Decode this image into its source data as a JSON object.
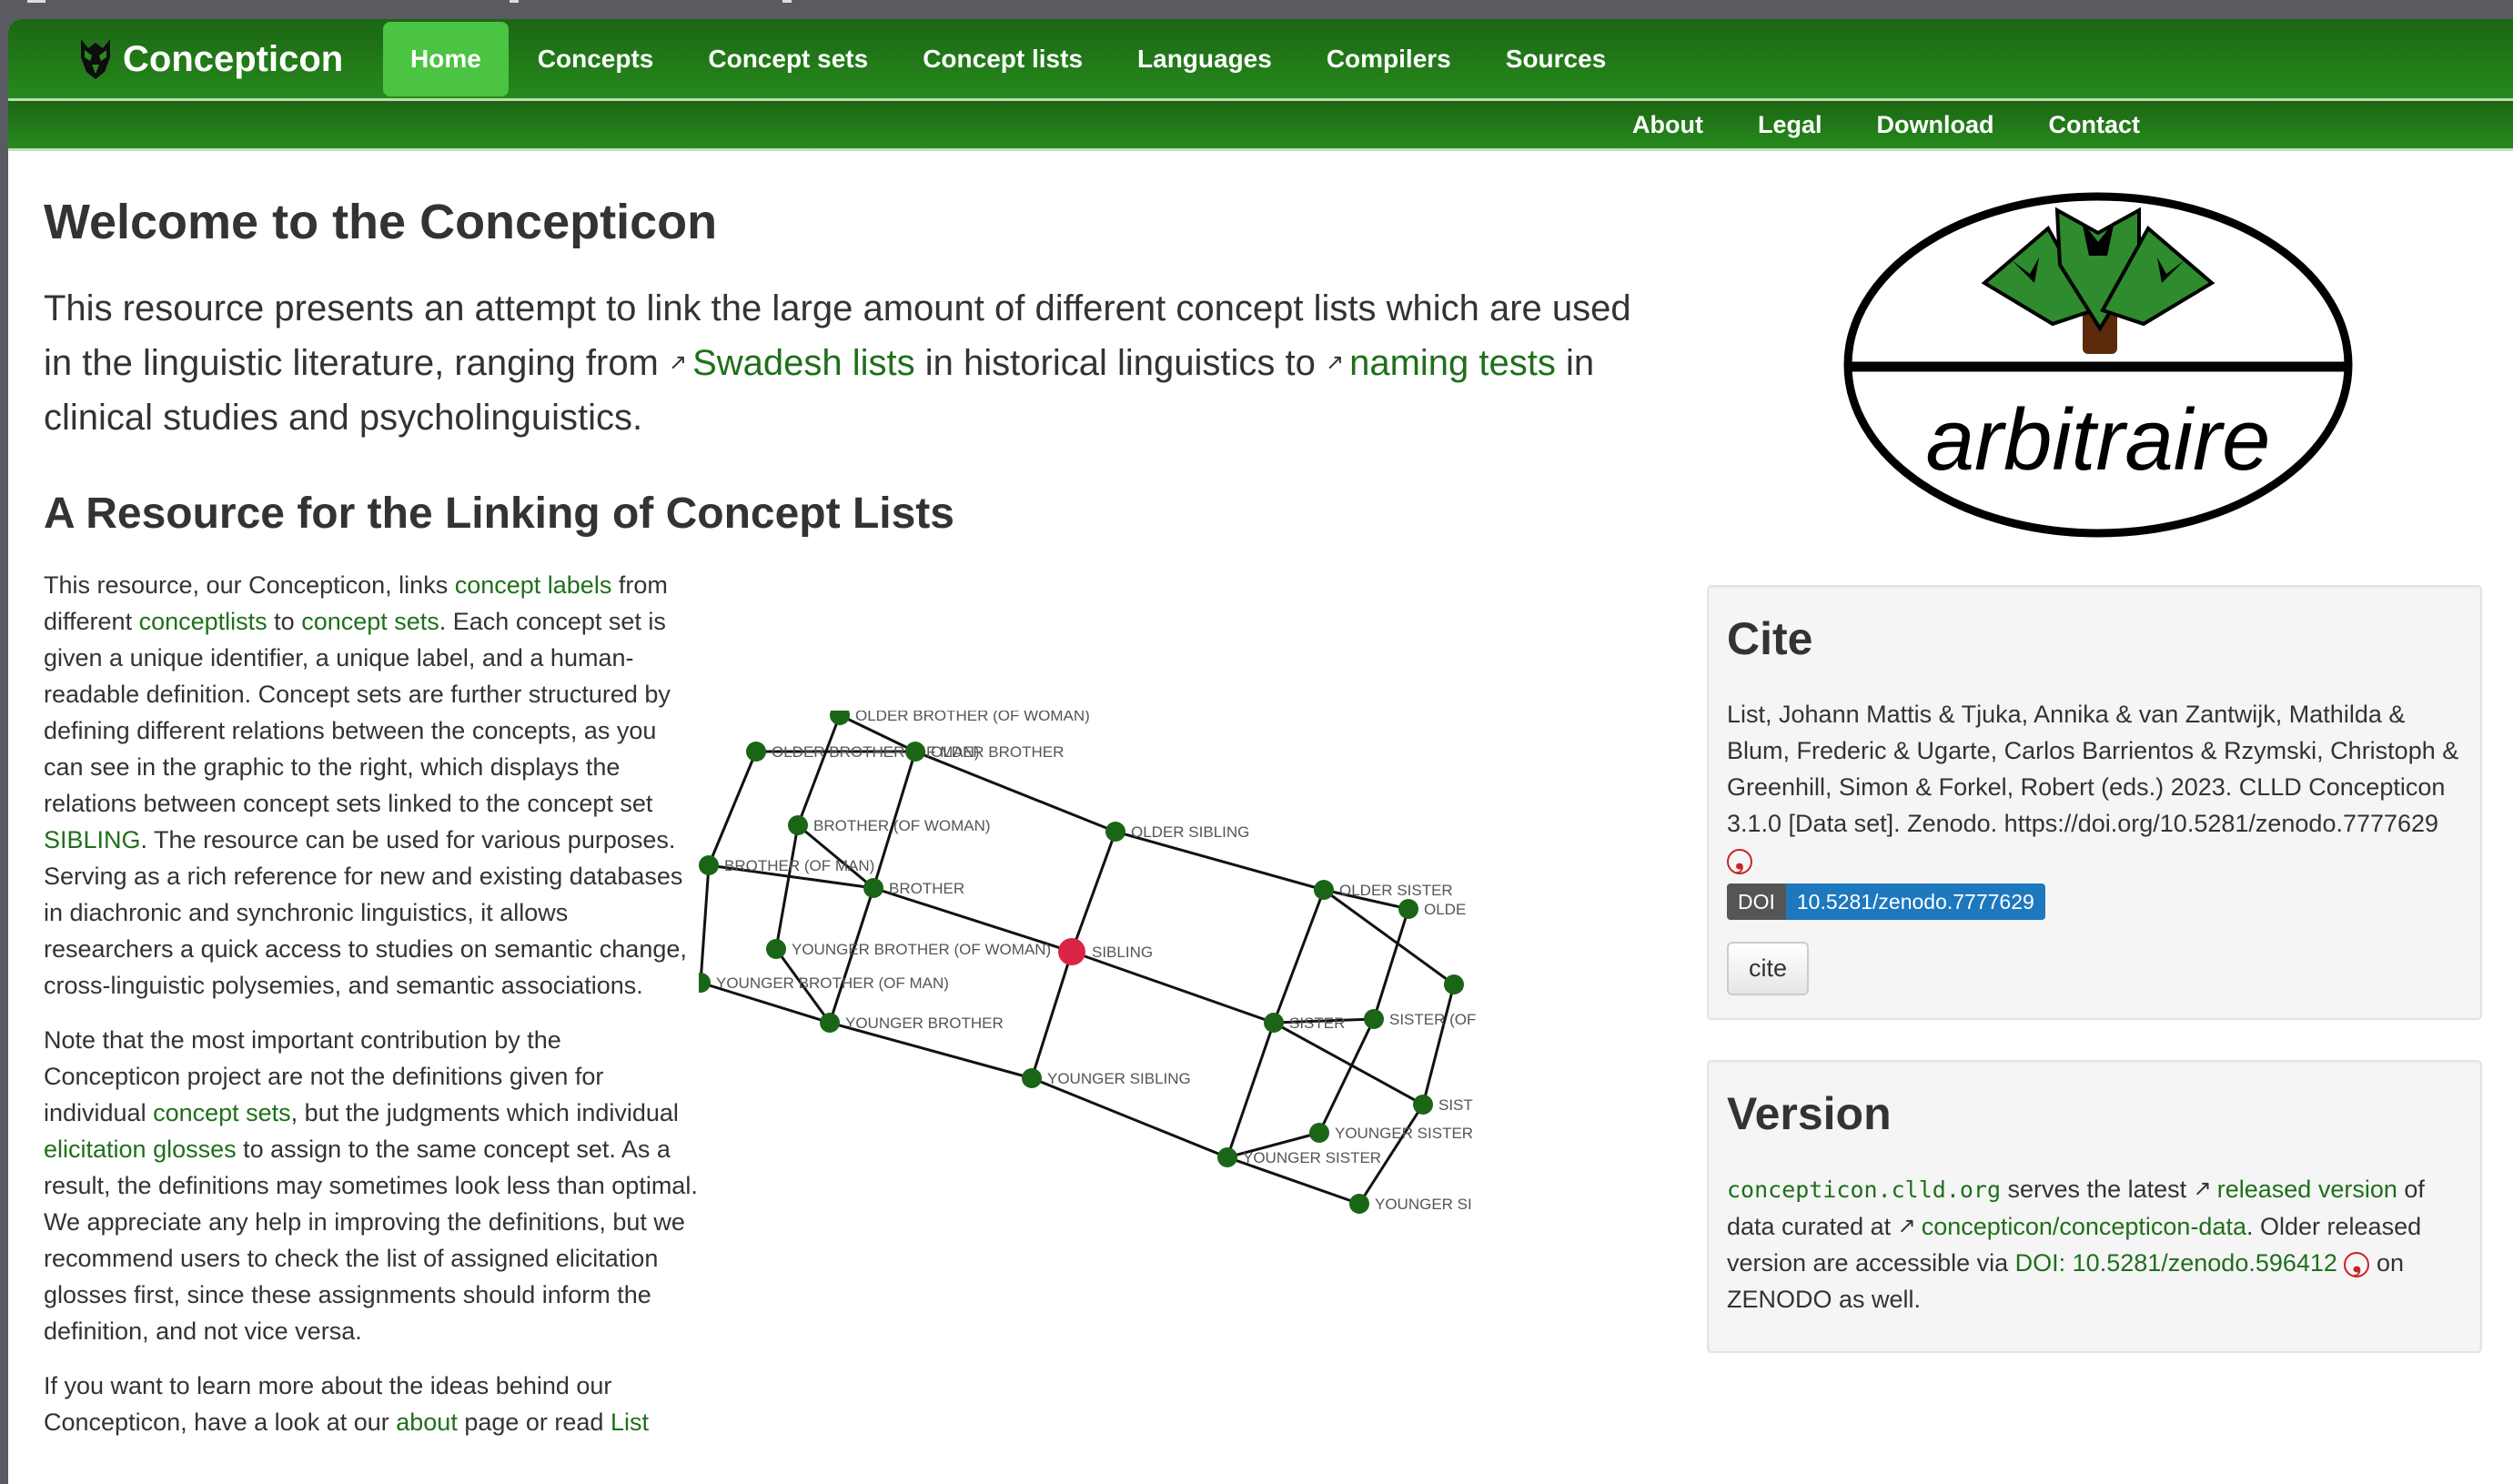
{
  "navbar": {
    "brand": "Concepticon",
    "items": [
      {
        "label": "Home",
        "active": true
      },
      {
        "label": "Concepts"
      },
      {
        "label": "Concept sets"
      },
      {
        "label": "Concept lists"
      },
      {
        "label": "Languages"
      },
      {
        "label": "Compilers"
      },
      {
        "label": "Sources"
      }
    ],
    "sub_items": [
      {
        "label": "About"
      },
      {
        "label": "Legal"
      },
      {
        "label": "Download"
      },
      {
        "label": "Contact"
      }
    ]
  },
  "main": {
    "title": "Welcome to the Concepticon",
    "lead": {
      "t1": "This resource presents an attempt to link the large amount of different concept lists which are used in the linguistic literature, ranging from ",
      "link1": "Swadesh lists",
      "t2": " in historical linguistics to ",
      "link2": "naming tests",
      "t3": " in clinical studies and psycholinguistics."
    },
    "subtitle": "A Resource for the Linking of Concept Lists",
    "p1": {
      "t1": "This resource, our Concepticon, links ",
      "l1": "concept labels",
      "t2": " from different ",
      "l2": "conceptlists",
      "t3": " to ",
      "l3": "concept sets",
      "t4": ". Each concept set is given a unique identifier, a unique label, and a human-readable definition. Concept sets are further structured by defining different relations between the concepts, as you can see in the graphic to the right, which displays the relations between concept sets linked to the concept set ",
      "l4": "SIBLING",
      "t5": ". The resource can be used for various purposes. Serving as a rich reference for new and existing databases in diachronic and synchronic linguistics, it allows researchers a quick access to studies on semantic change, cross-linguistic polysemies, and semantic associations."
    },
    "p2": {
      "t1": "Note that the most important contribution by the Concepticon project are not the definitions given for individual ",
      "l1": "concept sets",
      "t2": ", but the judgments which individual ",
      "l2": "elicitation glosses",
      "t3": " to assign to the same concept set. As a result, the definitions may sometimes look less than optimal. We appreciate any help in improving the definitions, but we recommend users to check the list of assigned elicitation glosses first, since these assignments should inform the definition, and not vice versa."
    },
    "p3": {
      "t1": "If you want to learn more about the ideas behind our Concepticon, have a look at our ",
      "l1": "about",
      "t2": " page or read ",
      "l2": "List"
    }
  },
  "graph": {
    "node_color": "#1a6616",
    "focus_color": "#dc2446",
    "nodes": [
      {
        "id": "obw",
        "label": "OLDER BROTHER (OF WOMAN)"
      },
      {
        "id": "obm",
        "label": "OLDER BROTHER (OF MAN)"
      },
      {
        "id": "ob",
        "label": "OLDER BROTHER"
      },
      {
        "id": "bw",
        "label": "BROTHER (OF WOMAN)"
      },
      {
        "id": "bm",
        "label": "BROTHER (OF MAN)"
      },
      {
        "id": "b",
        "label": "BROTHER"
      },
      {
        "id": "ybw",
        "label": "YOUNGER BROTHER (OF WOMAN)"
      },
      {
        "id": "ybm",
        "label": "YOUNGER BROTHER (OF MAN)"
      },
      {
        "id": "yb",
        "label": "YOUNGER BROTHER"
      },
      {
        "id": "sib",
        "label": "SIBLING",
        "focus": true
      },
      {
        "id": "os",
        "label": "OLDER SIBLING"
      },
      {
        "id": "ys",
        "label": "YOUNGER SIBLING"
      },
      {
        "id": "osis",
        "label": "OLDER SISTER"
      },
      {
        "id": "osis2",
        "label": "OLDE"
      },
      {
        "id": "osis3",
        "label": ""
      },
      {
        "id": "sis",
        "label": "SISTER"
      },
      {
        "id": "sis2",
        "label": "SISTER (OF"
      },
      {
        "id": "sis3",
        "label": "SIST"
      },
      {
        "id": "ysis2",
        "label": "YOUNGER SISTER"
      },
      {
        "id": "ysis",
        "label": "YOUNGER SISTER"
      },
      {
        "id": "ysis3",
        "label": "YOUNGER SI"
      }
    ],
    "edges": [
      [
        "obw",
        "ob"
      ],
      [
        "obw",
        "bw"
      ],
      [
        "obm",
        "ob"
      ],
      [
        "obm",
        "bm"
      ],
      [
        "ob",
        "b"
      ],
      [
        "ob",
        "os"
      ],
      [
        "bw",
        "b"
      ],
      [
        "bw",
        "ybw"
      ],
      [
        "bm",
        "b"
      ],
      [
        "bm",
        "ybm"
      ],
      [
        "b",
        "sib"
      ],
      [
        "b",
        "yb"
      ],
      [
        "ybw",
        "yb"
      ],
      [
        "ybm",
        "yb"
      ],
      [
        "yb",
        "ys"
      ],
      [
        "sib",
        "os"
      ],
      [
        "sib",
        "ys"
      ],
      [
        "sib",
        "sis"
      ],
      [
        "os",
        "osis"
      ],
      [
        "ys",
        "ysis"
      ],
      [
        "osis",
        "osis2"
      ],
      [
        "osis",
        "osis3"
      ],
      [
        "osis",
        "sis"
      ],
      [
        "osis2",
        "sis2"
      ],
      [
        "osis3",
        "sis3"
      ],
      [
        "sis",
        "sis2"
      ],
      [
        "sis",
        "sis3"
      ],
      [
        "sis",
        "ysis"
      ],
      [
        "sis2",
        "ysis2"
      ],
      [
        "sis3",
        "ysis3"
      ],
      [
        "ysis",
        "ysis2"
      ],
      [
        "ysis",
        "ysis3"
      ]
    ]
  },
  "logo": {
    "text": "arbitraire"
  },
  "cite": {
    "title": "Cite",
    "text": "List, Johann Mattis & Tjuka, Annika & van Zantwijk, Mathilda & Blum, Frederic & Ugarte, Carlos Barrientos & Rzymski, Christoph & Greenhill, Simon & Forkel, Robert (eds.) 2023. CLLD Concepticon 3.1.0 [Data set]. Zenodo. https://doi.org/10.5281/zenodo.7777629",
    "doi_label": "DOI",
    "doi_value": "10.5281/zenodo.7777629",
    "button": "cite"
  },
  "version": {
    "title": "Version",
    "site": "concepticon.clld.org",
    "t1": " serves the latest ",
    "l1": "released version",
    "t2": " of data curated at ",
    "l2": "concepticon/concepticon-data",
    "t3": ". Older released version are accessible via ",
    "l3": "DOI: 10.5281/zenodo.596412",
    "t4": " on ZENODO as well."
  },
  "icons": {
    "external_link": "↗",
    "zenodo": "❟"
  }
}
